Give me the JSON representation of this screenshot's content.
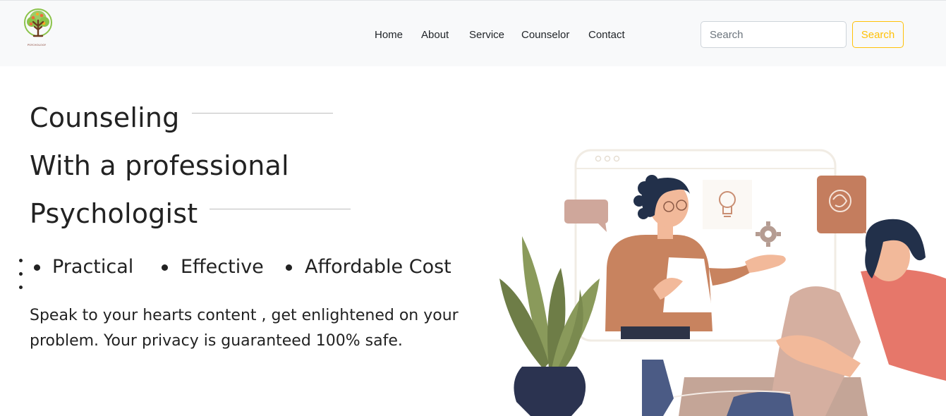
{
  "brand": {
    "logo_text": "PSYCHOLOGY"
  },
  "nav": {
    "items": [
      {
        "label": "Home"
      },
      {
        "label": "About"
      },
      {
        "label": "Service"
      },
      {
        "label": "Counselor"
      },
      {
        "label": "Contact"
      }
    ]
  },
  "search": {
    "placeholder": "Search",
    "value": "",
    "button_label": "Search"
  },
  "hero": {
    "title_lines": [
      "Counseling",
      "With a professional",
      "Psychologist"
    ],
    "features": [
      "Practical",
      "Effective",
      "Affordable Cost"
    ],
    "description": "Speak to your hearts content , get enlightened on your problem. Your privacy is guaranteed 100% safe."
  },
  "colors": {
    "navbar_bg": "#f8f9fa",
    "accent_warning": "#ffc107",
    "text": "#222222"
  },
  "icons": {
    "logo": "tree-logo-icon",
    "illustration": "counseling-session-illustration",
    "lightbulb": "lightbulb-icon",
    "gear": "gear-icon",
    "chat_bubble": "chat-bubble-icon"
  }
}
